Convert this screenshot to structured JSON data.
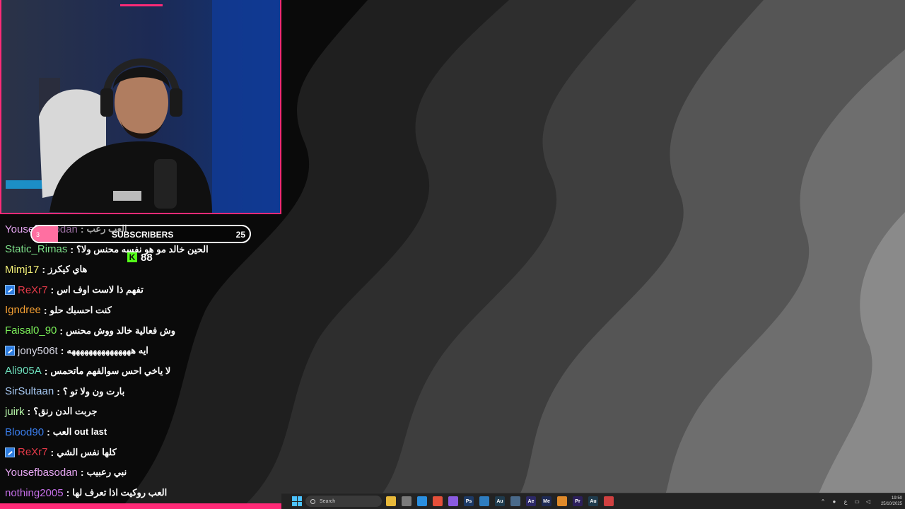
{
  "subscribers_bar": {
    "small_label": "3",
    "label": "SUBSCRIBERS",
    "goal": "25",
    "progress": 0.12
  },
  "kick_counter": {
    "icon": "K",
    "value": "88"
  },
  "chat": [
    {
      "user": "Yousefbasodan",
      "color": "#e6a6f2",
      "badge": false,
      "message": "العب رعب"
    },
    {
      "user": "Static_Rimas",
      "color": "#7ee08a",
      "badge": false,
      "message": "الحين خالد مو هو نفسه محنس ولا؟"
    },
    {
      "user": "Mimj17",
      "color": "#f5f178",
      "badge": false,
      "message": "هاي كيكرز"
    },
    {
      "user": "ReXr7",
      "color": "#e53a49",
      "badge": true,
      "message": "تفهم ذا لاست اوف اس"
    },
    {
      "user": "Igndree",
      "color": "#f5a033",
      "badge": false,
      "message": "كنت احسبك حلو"
    },
    {
      "user": "Faisal0_90",
      "color": "#7cf05a",
      "badge": false,
      "message": "وش فعالية خالد ووش محنس"
    },
    {
      "user": "jony506t",
      "color": "#d9d9e6",
      "badge": true,
      "message": "ايه هههههههههههههههه"
    },
    {
      "user": "Ali905A",
      "color": "#6ee0bd",
      "badge": false,
      "message": "لا ياخي احس سوالفهم ماتحمس"
    },
    {
      "user": "SirSultaan",
      "color": "#a6c8f2",
      "badge": false,
      "message": "بارت ون ولا تو ؟"
    },
    {
      "user": "juirk",
      "color": "#b6f5a8",
      "badge": false,
      "message": "جربت الدن رنق؟"
    },
    {
      "user": "Blood90",
      "color": "#3a7ff0",
      "badge": false,
      "message": "العب out last"
    },
    {
      "user": "ReXr7",
      "color": "#e53a49",
      "badge": true,
      "message": "كلها نفس الشي"
    },
    {
      "user": "Yousefbasodan",
      "color": "#e6a6f2",
      "badge": false,
      "message": "نبي رعبيب"
    },
    {
      "user": "nothing2005",
      "color": "#c66fe8",
      "badge": false,
      "message": "العب روكيت اذا تعرف لها"
    }
  ],
  "taskbar": {
    "search_placeholder": "Search",
    "apps": [
      {
        "name": "file-explorer",
        "label": "",
        "color": "#e8b93a"
      },
      {
        "name": "store",
        "label": "",
        "color": "#7a7a7a"
      },
      {
        "name": "vscode",
        "label": "",
        "color": "#2a8fe0"
      },
      {
        "name": "brave",
        "label": "",
        "color": "#e5503a"
      },
      {
        "name": "visual-studio",
        "label": "",
        "color": "#8a5be0"
      },
      {
        "name": "photoshop",
        "label": "Ps",
        "color": "#1d3a66"
      },
      {
        "name": "app-blue",
        "label": "",
        "color": "#2e7dc0"
      },
      {
        "name": "audition",
        "label": "Au",
        "color": "#1f3b4d"
      },
      {
        "name": "window",
        "label": "",
        "color": "#4a6a8a"
      },
      {
        "name": "after-effects",
        "label": "Ae",
        "color": "#2c2866"
      },
      {
        "name": "media-encoder",
        "label": "Me",
        "color": "#1e2a55"
      },
      {
        "name": "blender",
        "label": "",
        "color": "#e08a2a"
      },
      {
        "name": "premiere",
        "label": "Pr",
        "color": "#2c1f5c"
      },
      {
        "name": "audition-2",
        "label": "Au",
        "color": "#1f3b4d"
      },
      {
        "name": "chrome",
        "label": "",
        "color": "#d04040"
      }
    ],
    "tray": {
      "lang": "ع",
      "time": "19:50",
      "date": "25/10/2025"
    }
  }
}
